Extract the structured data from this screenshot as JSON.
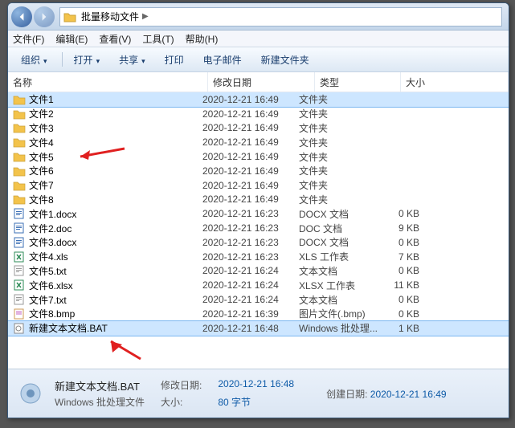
{
  "address": {
    "location": "批量移动文件"
  },
  "menu": {
    "file": "文件(F)",
    "edit": "编辑(E)",
    "view": "查看(V)",
    "tools": "工具(T)",
    "help": "帮助(H)"
  },
  "toolbar": {
    "organize": "组织",
    "open": "打开",
    "share": "共享",
    "print": "打印",
    "email": "电子邮件",
    "newfolder": "新建文件夹"
  },
  "columns": {
    "name": "名称",
    "date": "修改日期",
    "type": "类型",
    "size": "大小"
  },
  "files": [
    {
      "name": "文件1",
      "date": "2020-12-21 16:49",
      "type": "文件夹",
      "size": "",
      "icon": "folder",
      "sel": true
    },
    {
      "name": "文件2",
      "date": "2020-12-21 16:49",
      "type": "文件夹",
      "size": "",
      "icon": "folder"
    },
    {
      "name": "文件3",
      "date": "2020-12-21 16:49",
      "type": "文件夹",
      "size": "",
      "icon": "folder"
    },
    {
      "name": "文件4",
      "date": "2020-12-21 16:49",
      "type": "文件夹",
      "size": "",
      "icon": "folder"
    },
    {
      "name": "文件5",
      "date": "2020-12-21 16:49",
      "type": "文件夹",
      "size": "",
      "icon": "folder"
    },
    {
      "name": "文件6",
      "date": "2020-12-21 16:49",
      "type": "文件夹",
      "size": "",
      "icon": "folder"
    },
    {
      "name": "文件7",
      "date": "2020-12-21 16:49",
      "type": "文件夹",
      "size": "",
      "icon": "folder"
    },
    {
      "name": "文件8",
      "date": "2020-12-21 16:49",
      "type": "文件夹",
      "size": "",
      "icon": "folder"
    },
    {
      "name": "文件1.docx",
      "date": "2020-12-21 16:23",
      "type": "DOCX 文档",
      "size": "0 KB",
      "icon": "doc"
    },
    {
      "name": "文件2.doc",
      "date": "2020-12-21 16:23",
      "type": "DOC 文档",
      "size": "9 KB",
      "icon": "doc"
    },
    {
      "name": "文件3.docx",
      "date": "2020-12-21 16:23",
      "type": "DOCX 文档",
      "size": "0 KB",
      "icon": "doc"
    },
    {
      "name": "文件4.xls",
      "date": "2020-12-21 16:23",
      "type": "XLS 工作表",
      "size": "7 KB",
      "icon": "xls"
    },
    {
      "name": "文件5.txt",
      "date": "2020-12-21 16:24",
      "type": "文本文档",
      "size": "0 KB",
      "icon": "txt"
    },
    {
      "name": "文件6.xlsx",
      "date": "2020-12-21 16:24",
      "type": "XLSX 工作表",
      "size": "11 KB",
      "icon": "xls"
    },
    {
      "name": "文件7.txt",
      "date": "2020-12-21 16:24",
      "type": "文本文档",
      "size": "0 KB",
      "icon": "txt"
    },
    {
      "name": "文件8.bmp",
      "date": "2020-12-21 16:39",
      "type": "图片文件(.bmp)",
      "size": "0 KB",
      "icon": "bmp"
    },
    {
      "name": "新建文本文档.BAT",
      "date": "2020-12-21 16:48",
      "type": "Windows 批处理...",
      "size": "1 KB",
      "icon": "bat",
      "sel": true
    }
  ],
  "details": {
    "filename": "新建文本文档.BAT",
    "typelabel": "Windows 批处理文件",
    "modlabel": "修改日期:",
    "modval": "2020-12-21 16:48",
    "sizelabel": "大小:",
    "sizeval": "80 字节",
    "createlabel": "创建日期:",
    "createval": "2020-12-21 16:49"
  }
}
